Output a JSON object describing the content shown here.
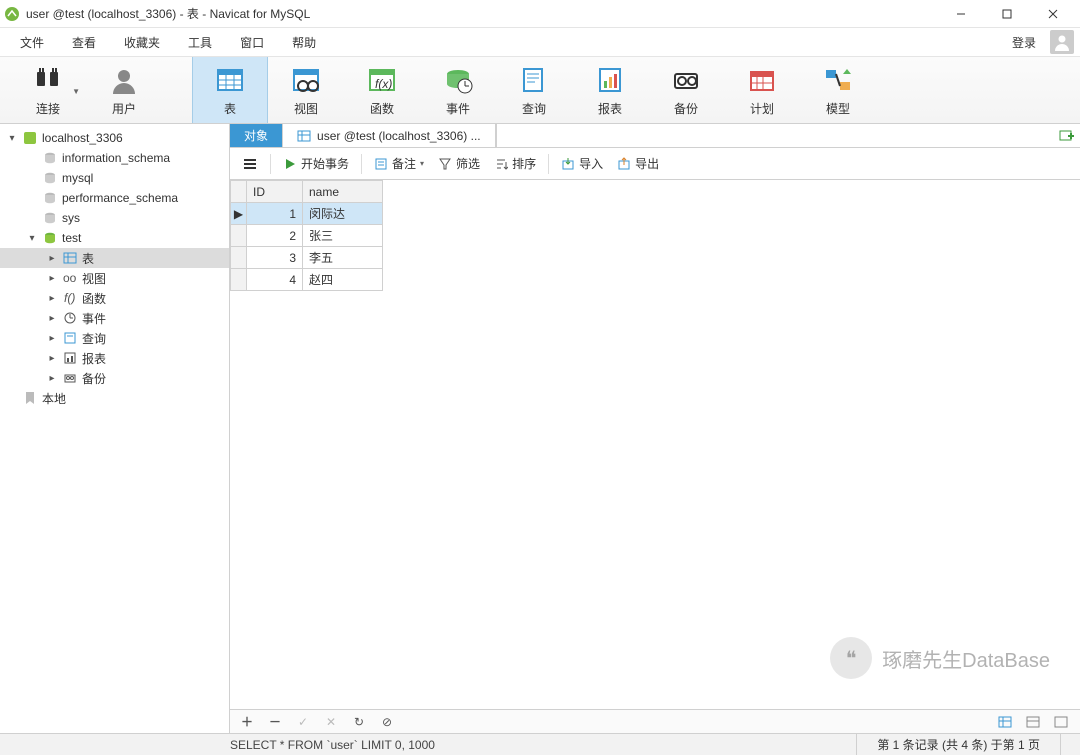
{
  "window": {
    "title": "user @test (localhost_3306) - 表 - Navicat for MySQL"
  },
  "menu": {
    "items": [
      "文件",
      "查看",
      "收藏夹",
      "工具",
      "窗口",
      "帮助"
    ],
    "login": "登录"
  },
  "toolbar": {
    "items": [
      {
        "label": "连接",
        "icon": "plug",
        "drop": true
      },
      {
        "label": "用户",
        "icon": "user"
      },
      {
        "label": "表",
        "icon": "table",
        "active": true
      },
      {
        "label": "视图",
        "icon": "view"
      },
      {
        "label": "函数",
        "icon": "fx"
      },
      {
        "label": "事件",
        "icon": "event"
      },
      {
        "label": "查询",
        "icon": "query"
      },
      {
        "label": "报表",
        "icon": "report"
      },
      {
        "label": "备份",
        "icon": "backup"
      },
      {
        "label": "计划",
        "icon": "schedule"
      },
      {
        "label": "模型",
        "icon": "model"
      }
    ]
  },
  "tree": {
    "conn": "localhost_3306",
    "dbs": [
      "information_schema",
      "mysql",
      "performance_schema",
      "sys"
    ],
    "opendb": "test",
    "children": [
      {
        "label": "表",
        "icon": "table",
        "sel": true
      },
      {
        "label": "视图",
        "icon": "view"
      },
      {
        "label": "函数",
        "icon": "fx"
      },
      {
        "label": "事件",
        "icon": "event"
      },
      {
        "label": "查询",
        "icon": "query"
      },
      {
        "label": "报表",
        "icon": "report"
      },
      {
        "label": "备份",
        "icon": "backup"
      }
    ],
    "local": "本地"
  },
  "tabs": {
    "objects": "对象",
    "current": "user @test (localhost_3306) ..."
  },
  "tabletoolbar": {
    "begin_tx": "开始事务",
    "memo": "备注",
    "filter": "筛选",
    "sort": "排序",
    "import": "导入",
    "export": "导出"
  },
  "grid": {
    "columns": [
      "ID",
      "name"
    ],
    "rows": [
      {
        "id": 1,
        "name": "闵际达",
        "sel": true
      },
      {
        "id": 2,
        "name": "张三"
      },
      {
        "id": 3,
        "name": "李五"
      },
      {
        "id": 4,
        "name": "赵四"
      }
    ]
  },
  "statusbar": {
    "sql": "SELECT * FROM `user` LIMIT 0, 1000",
    "recinfo": "第 1 条记录 (共 4 条) 于第 1 页"
  },
  "watermark": "琢磨先生DataBase"
}
